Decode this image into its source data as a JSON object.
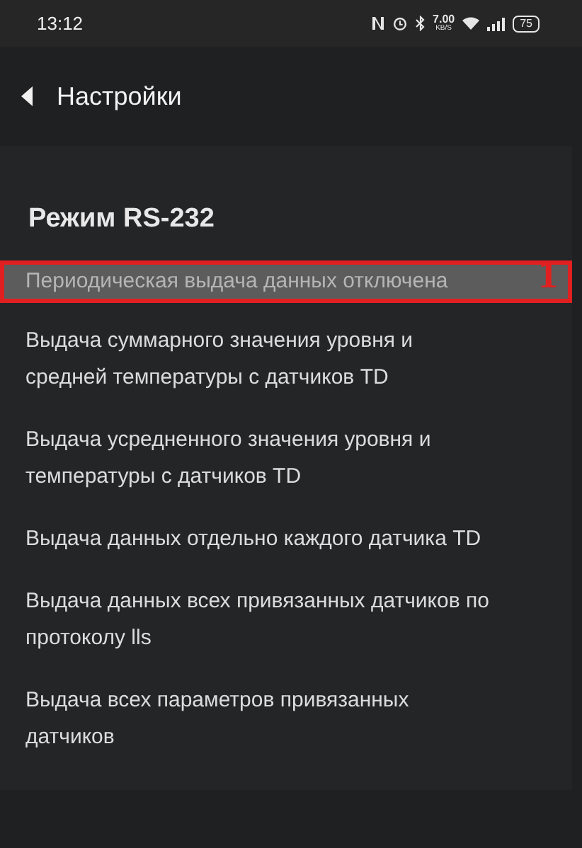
{
  "status_bar": {
    "time": "13:12",
    "speed_value": "7.00",
    "speed_unit": "KB/S",
    "battery": "75"
  },
  "header": {
    "title": "Настройки"
  },
  "section": {
    "title": "Режим RS-232",
    "items": [
      {
        "label": "Периодическая выдача данных отключена",
        "selected": true,
        "annotation": "1"
      },
      {
        "label": "Выдача суммарного значения уровня и средней температуры с датчиков TD",
        "selected": false
      },
      {
        "label": "Выдача усредненного значения уровня и температуры с датчиков TD",
        "selected": false
      },
      {
        "label": "Выдача данных отдельно каждого датчика TD",
        "selected": false
      },
      {
        "label": "Выдача данных всех привязанных датчиков по протоколу lls",
        "selected": false
      },
      {
        "label": "Выдача всех параметров привязанных датчиков",
        "selected": false
      }
    ]
  }
}
